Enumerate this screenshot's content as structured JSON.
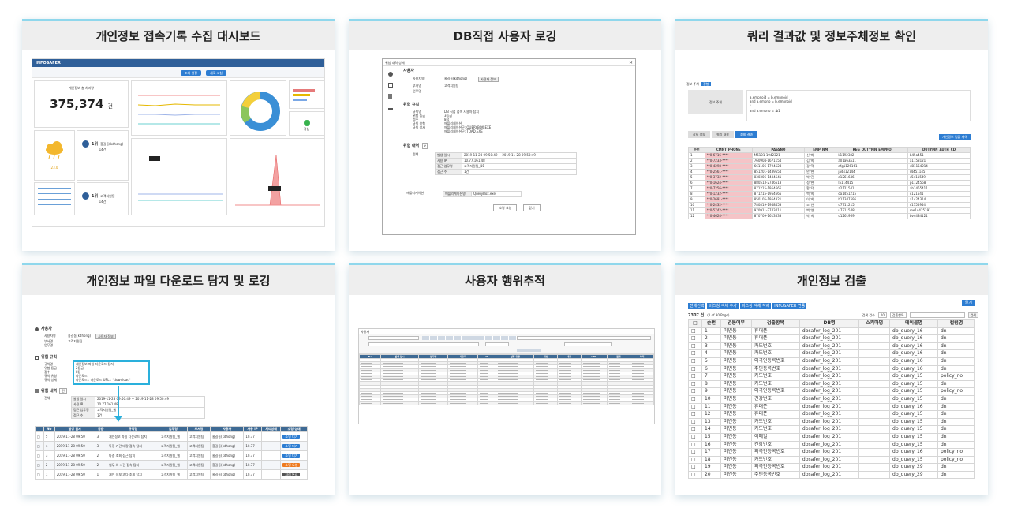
{
  "cards": [
    {
      "title": "개인정보 접속기록 수집 대시보드"
    },
    {
      "title": "DB직접 사용자 로깅"
    },
    {
      "title": "쿼리 결과값 및 정보주체정보 확인"
    },
    {
      "title": "개인정보 파일 다운로드 탐지 및 로깅"
    },
    {
      "title": "사용자 행위추적"
    },
    {
      "title": "개인정보 검출"
    }
  ],
  "dashboard": {
    "logo": "INFOSAFER",
    "total_label": "개인정보 총 처리량",
    "total_value": "375,374",
    "total_unit": "건",
    "user1_rank": "1위",
    "user1_name": "홍길동(kdhong)",
    "user1_count": "14건",
    "user2_rank": "1위",
    "user2_name": "고객지원팀",
    "user2_count": "14건",
    "risk_value": "23.0",
    "ok_label": "정상",
    "btn_search": "조회 설정",
    "btn_refresh": "새로 고침"
  },
  "db_log": {
    "modal_title": "위험 내역 상세",
    "sec_user": "사용자",
    "user_name_label": "사용자명",
    "user_name_value": "홍길동(kdhong)",
    "user_btn": "사용자 정보",
    "dept_label": "부서명",
    "dept_value": "고객지원팀",
    "job_label": "업무명",
    "sec_rule": "위험 규칙",
    "rule_rows": [
      {
        "k": "규칙명",
        "v": "DB 직접 접속 사용자 탐지"
      },
      {
        "k": "위험 등급",
        "v": "3등급"
      },
      {
        "k": "점수",
        "v": "8점"
      },
      {
        "k": "규칙 유형",
        "v": "애플리케이션"
      },
      {
        "k": "규칙 상세",
        "v": "애플리케이션군: QUERYBOX.EXE"
      },
      {
        "k": "",
        "v": "애플리케이션군: TOAD.EXE"
      }
    ],
    "sec_detail": "위험 내역",
    "detail_label": "전체",
    "detail_rows": [
      {
        "k": "발생 일시",
        "v": "2019-11-28 09:50:49 ~ 2019-11-28 09:50:49"
      },
      {
        "k": "사용 IP",
        "v": "10.77.161.48"
      },
      {
        "k": "접근 업무명",
        "v": "고객지원팀_DB"
      },
      {
        "k": "접근 수",
        "v": "1건"
      }
    ],
    "app_label": "애플리케이션",
    "app_key": "애플리케이션명",
    "app_value": "QueryBox.exe",
    "btn_exempt": "소명 요청",
    "btn_close": "닫기"
  },
  "query_result": {
    "tab_label": "정보 주체",
    "tab_btn": "정형",
    "box_label": "정보 주체",
    "sql_lines": [
      "(",
      "a.empnoid = b.empnoid",
      "and a.empno = b.empnoid",
      ")",
      "and a.empno = :b1"
    ],
    "tabs": [
      "상세 정보",
      "쿼리 내용",
      "조회 결과"
    ],
    "btn_detect": "개인정보 검출 재해",
    "columns": [
      "순번",
      "CMNT_PHONE",
      "PASSNO",
      "EMP_NM",
      "REG_DUTYMN_EMPNO",
      "DUTYMN_AUTH_CD"
    ],
    "rows": [
      [
        "1",
        "**0-6716-****",
        "M6101-1942321",
        "신*화",
        "k1192382",
        "b45a451"
      ],
      [
        "2",
        "**0-7233-****",
        "760904-1671154",
        "김*희",
        "a01a63a11",
        "a1158121"
      ],
      [
        "3",
        "**0-4298-****",
        "661106-1794524",
        "강*혁",
        "afg1126161",
        "d81154214"
      ],
      [
        "4",
        "**0-2561-****",
        "851201-1489554",
        "안*현",
        "ja4412144",
        "r4451145"
      ],
      [
        "5",
        "**0-3732-****",
        "830306-1434541",
        "박*진",
        "a1261646",
        "c5411549"
      ],
      [
        "6",
        "**0-1624-****",
        "880513-2746513",
        "정*현",
        "l5114415",
        "p1124558"
      ],
      [
        "7",
        "**0-7256-****",
        "871215-1954665",
        "황*덕",
        "a2121541",
        "ab1465411"
      ],
      [
        "8",
        "**0-1232-****",
        "871215-1954665",
        "백*희",
        "oa1451215",
        "c121541"
      ],
      [
        "9",
        "**0-2691-****",
        "850105-1954321",
        "이*희",
        "b11347595",
        "a1424314"
      ],
      [
        "10",
        "**0-2432-****",
        "780819-1948453",
        "조*연",
        "u7711215",
        "c1155954"
      ],
      [
        "11",
        "**0-5742-****",
        "970911-2743411",
        "백*영",
        "u7711548",
        "me14425191"
      ],
      [
        "12",
        "**0-4624-****",
        "870709-1613533",
        "박*희",
        "u1261969",
        "bv4484121"
      ]
    ]
  },
  "file_download": {
    "sec_user": "사용자",
    "user_rows": [
      {
        "k": "사용자명",
        "v": "홍길동(kdhong)",
        "btn": "사용자 정보"
      },
      {
        "k": "부서명",
        "v": "고객지원팀",
        "btn": ""
      },
      {
        "k": "업무명",
        "v": "",
        "btn": ""
      }
    ],
    "sec_rule": "위험 규칙",
    "rule_rows": [
      {
        "k": "규칙명",
        "v": "개인정보 파일 다운로드 탐지"
      },
      {
        "k": "위험 등급",
        "v": "2등급"
      },
      {
        "k": "점수",
        "v": "8점"
      },
      {
        "k": "규칙 유형",
        "v": "다운로드"
      },
      {
        "k": "규칙 상세",
        "v": "다운로드 : 다운로드 URL : *download*"
      }
    ],
    "sec_detail": "위험 내역",
    "detail_btn": "전",
    "detail_label": "전체",
    "detail_rows": [
      {
        "k": "발생 일시",
        "v": "2019-11-28 09:50:49 ~ 2019-11-28 09:50:49"
      },
      {
        "k": "사용 IP",
        "v": "10.77.161.48"
      },
      {
        "k": "접근 업무명",
        "v": "고객지원팀_웹"
      },
      {
        "k": "접근 수",
        "v": "1건"
      }
    ],
    "columns": [
      "",
      "No",
      "발생 일시",
      "등급",
      "규칙명",
      "업무명",
      "부서명",
      "사용자",
      "사용 IP",
      "처리상태",
      "소명 상태"
    ],
    "rows": [
      {
        "no": "5",
        "date": "2019-11-28 09:50",
        "grade": "3",
        "rule": "개인정보 파일 다운로드 탐지",
        "app": "고객지원팀_웹",
        "dept": "고객지원팀",
        "user": "홍길동(kdhong)",
        "ip": "10.77",
        "status": "소명 대기",
        "color": "#2d7dd2"
      },
      {
        "no": "4",
        "date": "2019-11-28 09:50",
        "grade": "3",
        "rule": "특정 기간 대량 접속 탐지",
        "app": "고객지원팀_웹",
        "dept": "고객지원팀",
        "user": "홍길동(kdhong)",
        "ip": "10.77",
        "status": "소명 대기",
        "color": "#2d7dd2"
      },
      {
        "no": "3",
        "date": "2019-11-28 09:50",
        "grade": "2",
        "rule": "다중 조회 접근 탐지",
        "app": "고객지원팀_웹",
        "dept": "고객지원팀",
        "user": "홍길동(kdhong)",
        "ip": "10.77",
        "status": "소명 대기",
        "color": "#2d7dd2"
      },
      {
        "no": "2",
        "date": "2019-11-28 09:50",
        "grade": "2",
        "rule": "업무 외 시간 접속 탐지",
        "app": "고객지원팀_웹",
        "dept": "고객지원팀",
        "user": "홍길동(kdhong)",
        "ip": "10.77",
        "status": "소명 요청",
        "color": "#ee7a1e"
      },
      {
        "no": "1",
        "date": "2019-11-28 09:50",
        "grade": "1",
        "rule": "개인 정보 과다 조회 탐지",
        "app": "고객지원팀_웹",
        "dept": "고객지원팀",
        "user": "홍길동(kdhong)",
        "ip": "10.77",
        "status": "처리 완료",
        "color": "#555555"
      }
    ]
  },
  "tracking": {
    "header_label": "사용자",
    "columns": [
      "No",
      "발생 일시",
      "업무명",
      "사용자",
      "IP",
      "실행 유형",
      "대상",
      "내용",
      "URL",
      "결과",
      "처리"
    ]
  },
  "detection": {
    "tabs": [
      "전체선택",
      "미스칭 객체 추가",
      "미스칭 객체 삭제",
      "INFOSAFER 연동"
    ],
    "btn_help": "알기",
    "count_label": "7307 건",
    "page_info": "(1 of 30 Page)",
    "page_size_label": "검색 건수",
    "page_size_value": "20",
    "search_select": "검출항목",
    "search_btn": "검색",
    "columns": [
      "순번",
      "연동여부",
      "검출항목",
      "DB명",
      "스키마명",
      "테이블명",
      "컬럼명"
    ],
    "rows": [
      [
        "1",
        "미연동",
        "휴대폰",
        "dbsafer_log_201",
        "",
        "db_query_16",
        "dn"
      ],
      [
        "2",
        "미연동",
        "휴대폰",
        "dbsafer_log_201",
        "",
        "db_query_16",
        "dn"
      ],
      [
        "3",
        "미연동",
        "카드번호",
        "dbsafer_log_201",
        "",
        "db_query_16",
        "dn"
      ],
      [
        "4",
        "미연동",
        "카드번호",
        "dbsafer_log_201",
        "",
        "db_query_16",
        "dn"
      ],
      [
        "5",
        "미연동",
        "외국인등록번호",
        "dbsafer_log_201",
        "",
        "db_query_16",
        "dn"
      ],
      [
        "6",
        "미연동",
        "주민등록번호",
        "dbsafer_log_201",
        "",
        "db_query_16",
        "dn"
      ],
      [
        "7",
        "미연동",
        "카드번호",
        "dbsafer_log_201",
        "",
        "db_query_15",
        "policy_no"
      ],
      [
        "8",
        "미연동",
        "카드번호",
        "dbsafer_log_201",
        "",
        "db_query_15",
        "dn"
      ],
      [
        "9",
        "미연동",
        "외국인등록번호",
        "dbsafer_log_201",
        "",
        "db_query_15",
        "policy_no"
      ],
      [
        "10",
        "미연동",
        "건강번호",
        "dbsafer_log_201",
        "",
        "db_query_15",
        "dn"
      ],
      [
        "11",
        "미연동",
        "휴대폰",
        "dbsafer_log_201",
        "",
        "db_query_16",
        "dn"
      ],
      [
        "12",
        "미연동",
        "휴대폰",
        "dbsafer_log_201",
        "",
        "db_query_15",
        "dn"
      ],
      [
        "13",
        "미연동",
        "카드번호",
        "dbsafer_log_201",
        "",
        "db_query_15",
        "dn"
      ],
      [
        "14",
        "미연동",
        "카드번호",
        "dbsafer_log_201",
        "",
        "db_query_15",
        "dn"
      ],
      [
        "15",
        "미연동",
        "이메일",
        "dbsafer_log_201",
        "",
        "db_query_15",
        "dn"
      ],
      [
        "16",
        "미연동",
        "건강번호",
        "dbsafer_log_201",
        "",
        "db_query_15",
        "dn"
      ],
      [
        "17",
        "미연동",
        "외국인등록번호",
        "dbsafer_log_201",
        "",
        "db_query_16",
        "policy_no"
      ],
      [
        "18",
        "미연동",
        "카드번호",
        "dbsafer_log_201",
        "",
        "db_query_15",
        "policy_no"
      ],
      [
        "19",
        "미연동",
        "외국인등록번호",
        "dbsafer_log_201",
        "",
        "db_query_29",
        "dn"
      ],
      [
        "20",
        "미연동",
        "주민등록번호",
        "dbsafer_log_201",
        "",
        "db_query_29",
        "dn"
      ]
    ]
  }
}
